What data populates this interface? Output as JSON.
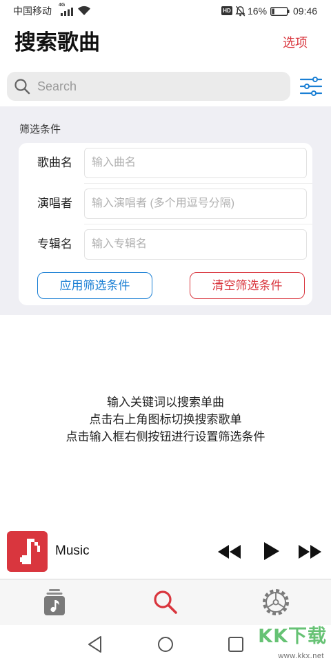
{
  "status_bar": {
    "carrier": "中国移动",
    "network": "4G",
    "hd_badge": "HD",
    "battery_percent": "16%",
    "battery_level": 0.16,
    "time": "09:46",
    "icons": [
      "signal-icon",
      "wifi-icon",
      "hd-icon",
      "bell-off-icon",
      "battery-icon"
    ]
  },
  "header": {
    "title": "搜索歌曲",
    "options_label": "选项"
  },
  "search": {
    "placeholder": "Search",
    "icon": "search-icon",
    "filter_toggle_icon": "filter-sliders-icon"
  },
  "filters": {
    "section_title": "筛选条件",
    "fields": [
      {
        "label": "歌曲名",
        "placeholder": "输入曲名"
      },
      {
        "label": "演唱者",
        "placeholder": "输入演唱者 (多个用逗号分隔)"
      },
      {
        "label": "专辑名",
        "placeholder": "输入专辑名"
      }
    ],
    "apply_label": "应用筛选条件",
    "clear_label": "清空筛选条件"
  },
  "hints": [
    "输入关键词以搜索单曲",
    "点击右上角图标切换搜索歌单",
    "点击输入框右侧按钮进行设置筛选条件"
  ],
  "player": {
    "title": "Music",
    "artwork_icon": "music-note-icon",
    "controls": [
      "previous-icon",
      "play-icon",
      "next-icon"
    ]
  },
  "tab_bar": {
    "tabs": [
      {
        "icon": "music-library-icon",
        "active": false
      },
      {
        "icon": "search-icon",
        "active": true
      },
      {
        "icon": "settings-gear-icon",
        "active": false
      }
    ]
  },
  "nav_bar": {
    "icons": [
      "back-icon",
      "home-icon",
      "recents-icon"
    ]
  },
  "watermark": {
    "brand": "KK下载",
    "url": "www.kkx.net"
  },
  "colors": {
    "accent_red": "#d9363e",
    "accent_blue": "#1a7fd4",
    "panel_bg": "#efeff4",
    "search_bg": "#ebebeb"
  }
}
